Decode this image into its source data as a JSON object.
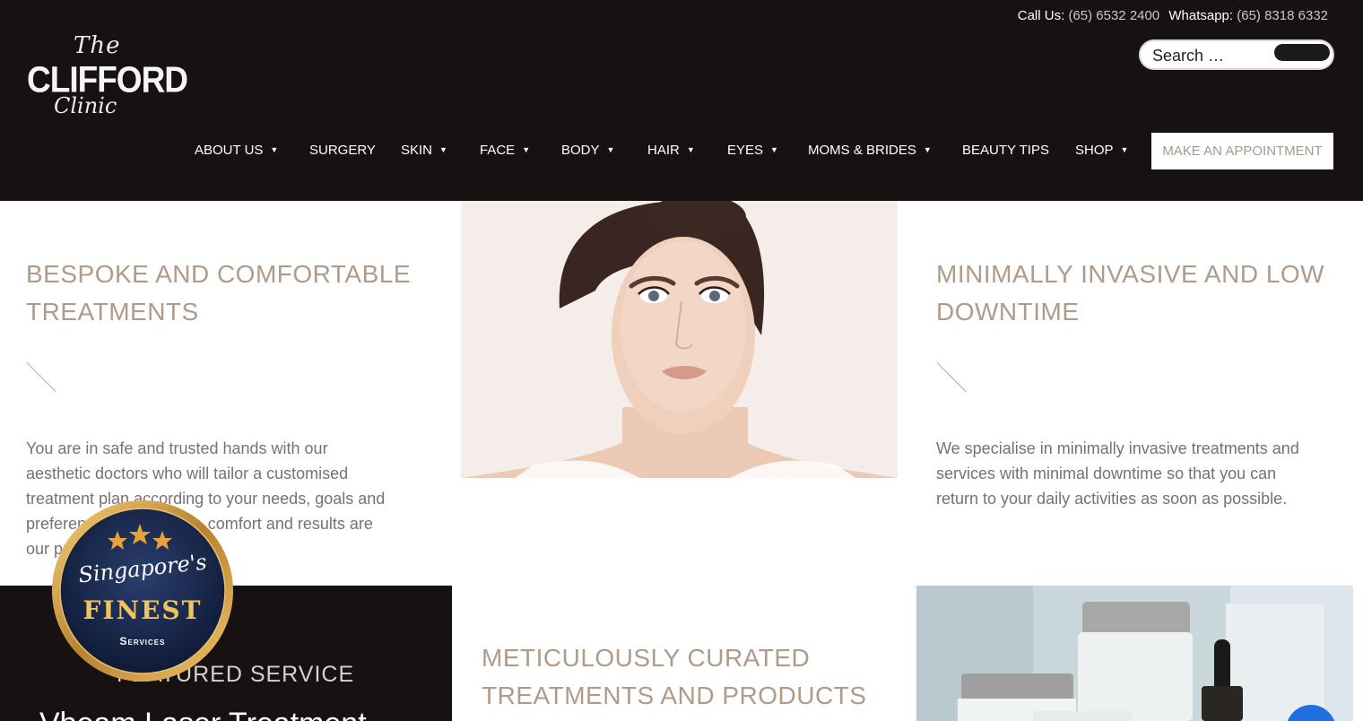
{
  "brand": {
    "logo_top": "The",
    "logo_main": "CLIFFORD",
    "logo_bottom": "Clinic"
  },
  "contact": {
    "call_label": "Call Us:",
    "call_number": "(65) 6532 2400",
    "whatsapp_label": "Whatsapp:",
    "whatsapp_number": "(65) 8318 6332"
  },
  "search": {
    "placeholder": "Search …"
  },
  "nav": {
    "items": [
      {
        "label": "ABOUT US",
        "dropdown": true
      },
      {
        "label": "SURGERY",
        "dropdown": false
      },
      {
        "label": "SKIN",
        "dropdown": true
      },
      {
        "label": "FACE",
        "dropdown": true
      },
      {
        "label": "BODY",
        "dropdown": true
      },
      {
        "label": "HAIR",
        "dropdown": true
      },
      {
        "label": "EYES",
        "dropdown": true
      },
      {
        "label": "MOMS & BRIDES",
        "dropdown": true
      },
      {
        "label": "BEAUTY TIPS",
        "dropdown": false
      },
      {
        "label": "SHOP",
        "dropdown": true
      }
    ],
    "cta": "MAKE AN APPOINTMENT",
    "caret": "▼"
  },
  "features": {
    "bespoke": {
      "title_line1": "BESPOKE AND COMFORTABLE",
      "title_line2": "TREATMENTS",
      "text_lines": [
        "You are in safe and trusted hands with our",
        "aesthetic doctors who will tailor a customised",
        "treatment plan according to your needs, goals and",
        "preferences. Your safety, comfort and results are",
        "our priority."
      ]
    },
    "minimal": {
      "title_line1": "MINIMALLY INVASIVE AND LOW",
      "title_line2": "DOWNTIME",
      "text_lines": [
        "We specialise in minimally invasive treatments and",
        "services with minimal downtime so that you can",
        "return to your daily activities as soon as possible."
      ]
    },
    "curated": {
      "title_line1": "METICULOUSLY CURATED",
      "title_line2": "TREATMENTS AND PRODUCTS"
    }
  },
  "featured_service": {
    "label": "FEATURED SERVICE",
    "title": "Vbeam Laser Treatment"
  },
  "badge": {
    "line1": "Singapore's",
    "line2": "FINEST",
    "line3": "Services"
  },
  "colors": {
    "header_bg": "#171112",
    "accent_taupe": "#b09a8a",
    "body_text": "#7a716e",
    "badge_navy": "#14203f",
    "badge_gold": "#d7a94c"
  }
}
